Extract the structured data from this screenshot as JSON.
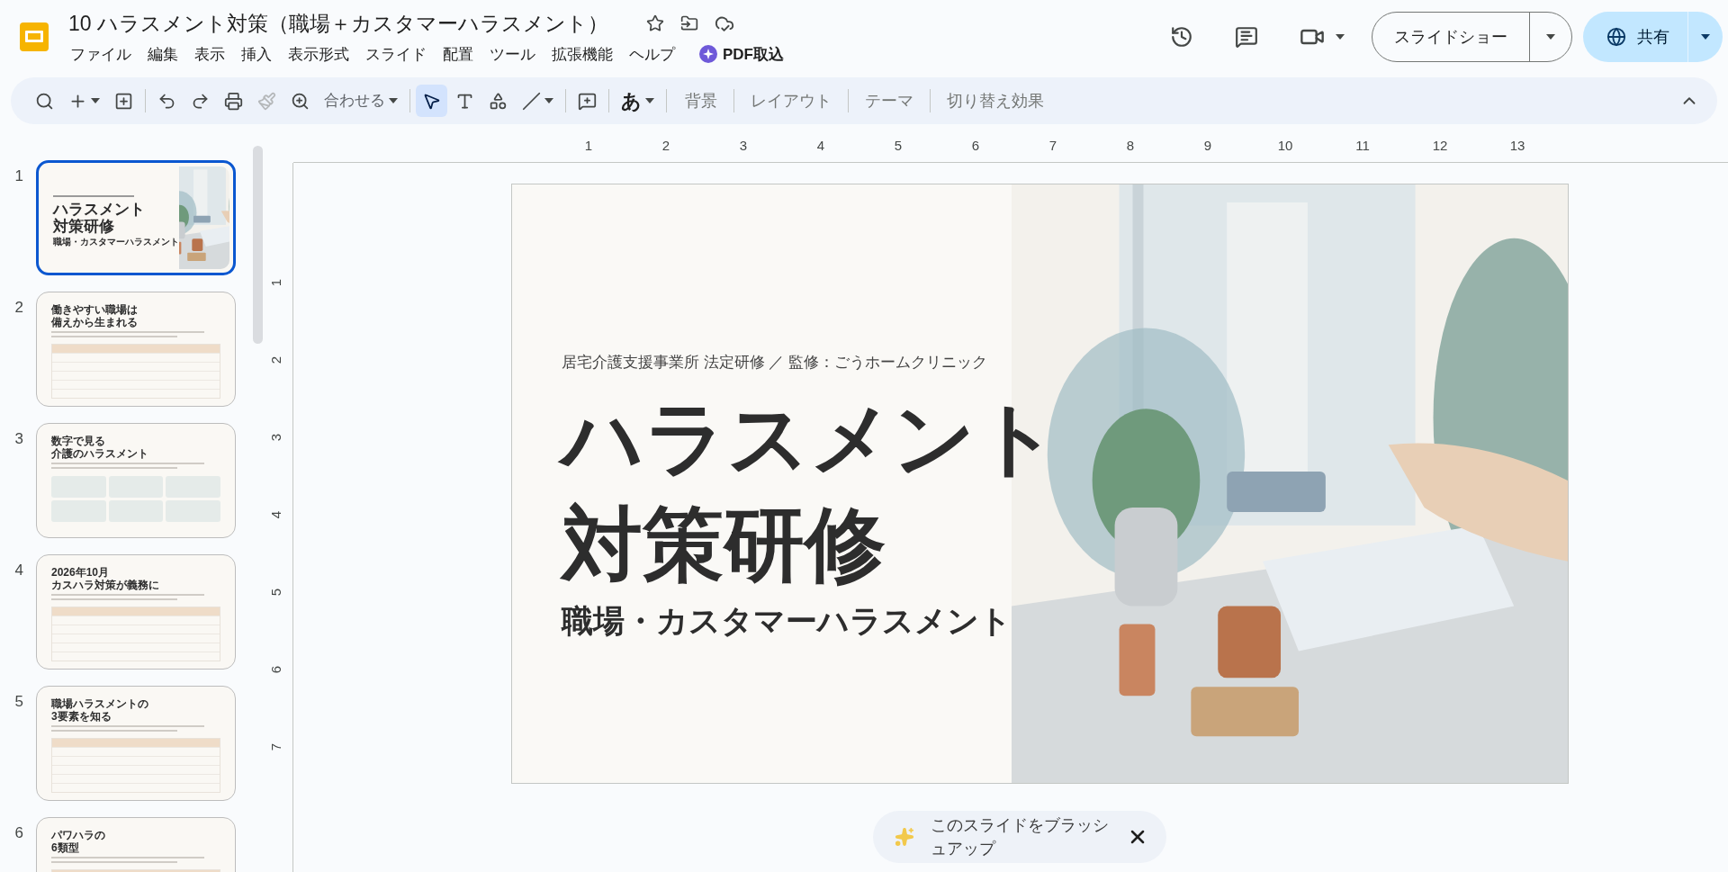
{
  "document": {
    "title": "10 ハラスメント対策（職場＋カスタマーハラスメント）"
  },
  "menu": [
    "ファイル",
    "編集",
    "表示",
    "挿入",
    "表示形式",
    "スライド",
    "配置",
    "ツール",
    "拡張機能",
    "ヘルプ"
  ],
  "pdf_button": "PDF取込",
  "header": {
    "slideshow": "スライドショー",
    "share": "共有"
  },
  "toolbar": {
    "groups": [
      [
        {
          "kind": "search",
          "selected": false
        },
        {
          "kind": "add",
          "selected": false
        },
        {
          "kind": "new-slide",
          "selected": false
        }
      ],
      [
        {
          "kind": "undo",
          "selected": false
        },
        {
          "kind": "redo",
          "selected": false
        },
        {
          "kind": "print",
          "selected": false
        },
        {
          "kind": "paint",
          "selected": false
        },
        {
          "kind": "zoom",
          "selected": false
        },
        {
          "kind": "zoom-menu",
          "selected": false
        }
      ],
      [
        {
          "kind": "select",
          "selected": true
        },
        {
          "kind": "text",
          "selected": false
        },
        {
          "kind": "shape",
          "selected": false
        },
        {
          "kind": "line",
          "selected": false
        }
      ],
      [
        {
          "kind": "comment",
          "selected": false
        }
      ],
      [
        {
          "kind": "input",
          "selected": false
        }
      ]
    ],
    "zoom_label": "合わせる",
    "input_label": "あ",
    "text_buttons": [
      "背景",
      "レイアウト",
      "テーマ",
      "切り替え効果"
    ]
  },
  "ruler": {
    "horizontal": [
      "1",
      "2",
      "3",
      "4",
      "5",
      "6",
      "7",
      "8",
      "9",
      "10",
      "11",
      "12",
      "13"
    ],
    "vertical": [
      "1",
      "2",
      "3",
      "4",
      "5",
      "6",
      "7"
    ]
  },
  "slides": [
    {
      "number": "1",
      "selected": true,
      "kind": "title",
      "title": [
        "ハラスメント",
        "対策研修"
      ],
      "subtitle": "職場・カスタマーハラスメント"
    },
    {
      "number": "2",
      "selected": false,
      "kind": "table",
      "title": [
        "働きやすい職場は",
        "備えから生まれる"
      ]
    },
    {
      "number": "3",
      "selected": false,
      "kind": "cards",
      "title": [
        "数字で見る",
        "介護のハラスメント"
      ]
    },
    {
      "number": "4",
      "selected": false,
      "kind": "table",
      "title": [
        "2026年10月",
        "カスハラ対策が義務に"
      ]
    },
    {
      "number": "5",
      "selected": false,
      "kind": "table",
      "title": [
        "職場ハラスメントの",
        "3要素を知る"
      ]
    },
    {
      "number": "6",
      "selected": false,
      "kind": "table",
      "title": [
        "パワハラの",
        "6類型"
      ]
    }
  ],
  "current_slide": {
    "kicker": "居宅介護支援事業所 法定研修 ／ 監修：ごうホームクリニック",
    "title": [
      "ハラスメント",
      "対策研修"
    ],
    "subtitle": "職場・カスタマーハラスメント"
  },
  "suggestion": {
    "text": "このスライドをブラッシュアップ"
  }
}
